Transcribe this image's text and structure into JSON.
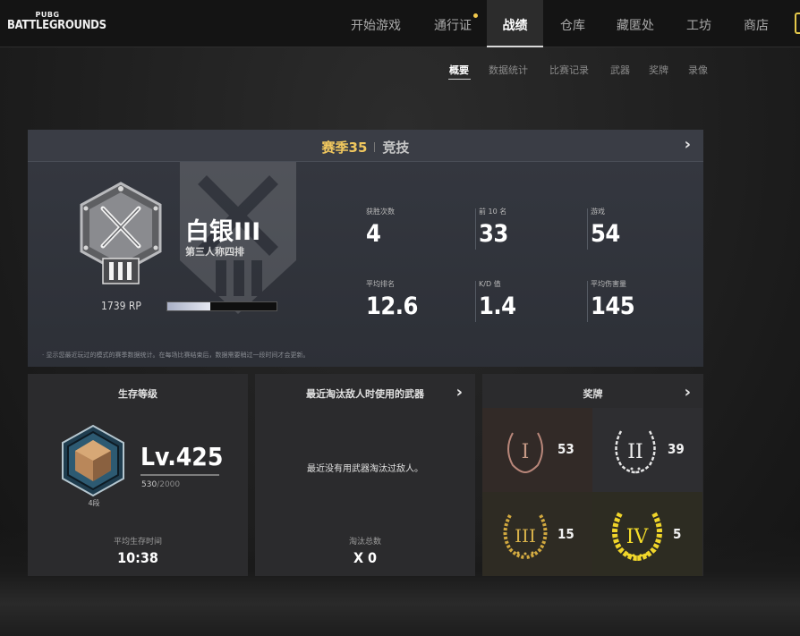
{
  "brand": {
    "top": "PUBG",
    "bottom": "BATTLEGROUNDS"
  },
  "nav": {
    "items": [
      {
        "label": "开始游戏"
      },
      {
        "label": "通行证"
      },
      {
        "label": "战绩"
      },
      {
        "label": "仓库"
      },
      {
        "label": "藏匿处"
      },
      {
        "label": "工坊"
      },
      {
        "label": "商店"
      }
    ],
    "active": "战绩"
  },
  "subnav": {
    "items": [
      {
        "label": "概要"
      },
      {
        "label": "数据统计"
      },
      {
        "label": "比赛记录"
      },
      {
        "label": "武器"
      },
      {
        "label": "奖牌"
      },
      {
        "label": "录像"
      }
    ],
    "active": "概要"
  },
  "season": {
    "season_label": "赛季35",
    "mode_label": "竞技",
    "rank_name": "白银III",
    "perspective": "第三人称四排",
    "rp_text": "1739 RP",
    "rp_progress": 0.39,
    "stats": [
      {
        "label": "获胜次数",
        "value": "4"
      },
      {
        "label": "前 10 名",
        "value": "33"
      },
      {
        "label": "游戏",
        "value": "54"
      },
      {
        "label": "平均排名",
        "value": "12.6"
      },
      {
        "label": "K/D 值",
        "value": "1.4"
      },
      {
        "label": "平均伤害量",
        "value": "145"
      }
    ],
    "note": "· 显示您最近玩过的模式的赛季数据统计。在每场比赛结束后，数据需要稍过一段时间才会更新。"
  },
  "survival": {
    "title": "生存等级",
    "level": "Lv.425",
    "xp_current": "530",
    "xp_max": "/2000",
    "tier": "4段",
    "avg_survival_label": "平均生存时间",
    "avg_survival_value": "10:38"
  },
  "weapon": {
    "title": "最近淘汰敌人时使用的武器",
    "empty_text": "最近没有用武器淘汰过敌人。",
    "total_label": "淘汰总数",
    "total_value": "X 0"
  },
  "medals": {
    "title": "奖牌",
    "items": [
      {
        "numeral": "I",
        "count": "53",
        "color": "#c79a86"
      },
      {
        "numeral": "II",
        "count": "39",
        "color": "#e9e9e9"
      },
      {
        "numeral": "III",
        "count": "15",
        "color": "#d9b24a"
      },
      {
        "numeral": "IV",
        "count": "5",
        "color": "#f4dc2a"
      }
    ]
  }
}
